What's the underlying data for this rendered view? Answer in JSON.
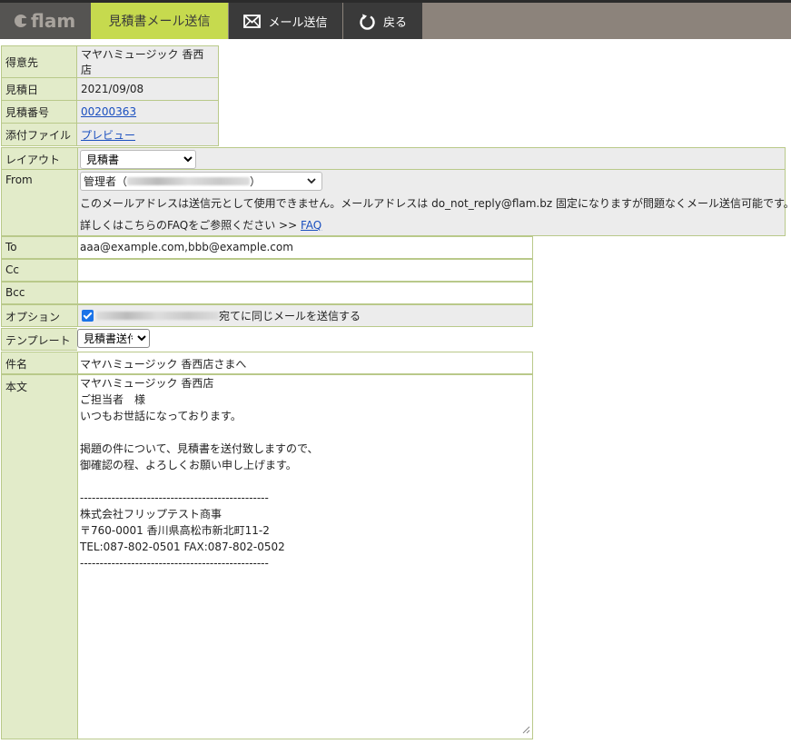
{
  "app": {
    "logo_text": "flam"
  },
  "tabs": {
    "active": "見積書メール送信",
    "send_mail": "メール送信",
    "back": "戻る"
  },
  "info": {
    "customer_label": "得意先",
    "customer_value": "マヤハミュージック 香西店",
    "date_label": "見積日",
    "date_value": "2021/09/08",
    "number_label": "見積番号",
    "number_value": "00200363",
    "attachment_label": "添付ファイル",
    "attachment_value": "プレビュー"
  },
  "form": {
    "layout_label": "レイアウト",
    "layout_value": "見積書",
    "from_label": "From",
    "from_value_prefix": "管理者（",
    "from_value_suffix": "）",
    "from_notice": "このメールアドレスは送信元として使用できません。メールアドレスは do_not_reply@flam.bz 固定になりますが問題なくメール送信可能です。",
    "faq_text_prefix": "詳しくはこちらのFAQをご参照ください >> ",
    "faq_link": "FAQ",
    "to_label": "To",
    "to_value": "aaa@example.com,bbb@example.com",
    "cc_label": "Cc",
    "cc_value": "",
    "bcc_label": "Bcc",
    "bcc_value": "",
    "option_label": "オプション",
    "option_text": "宛てに同じメールを送信する",
    "template_label": "テンプレート",
    "template_value": "見積書送付",
    "subject_label": "件名",
    "subject_value": "マヤハミュージック 香西店さまへ",
    "body_label": "本文",
    "body_value": "マヤハミュージック 香西店\nご担当者　様\nいつもお世話になっております。\n\n掲題の件について、見積書を送付致しますので、\n御確認の程、よろしくお願い申し上げます。\n\n------------------------------------------------\n株式会社フリップテスト商事\n〒760-0001 香川県高松市新北町11-2\nTEL:087-802-0501 FAX:087-802-0502\n------------------------------------------------"
  },
  "colors": {
    "accent": "#c6da4e",
    "label_bg": "#e2ebc9",
    "border": "#b9c98a",
    "topbar": "#8c837b"
  }
}
